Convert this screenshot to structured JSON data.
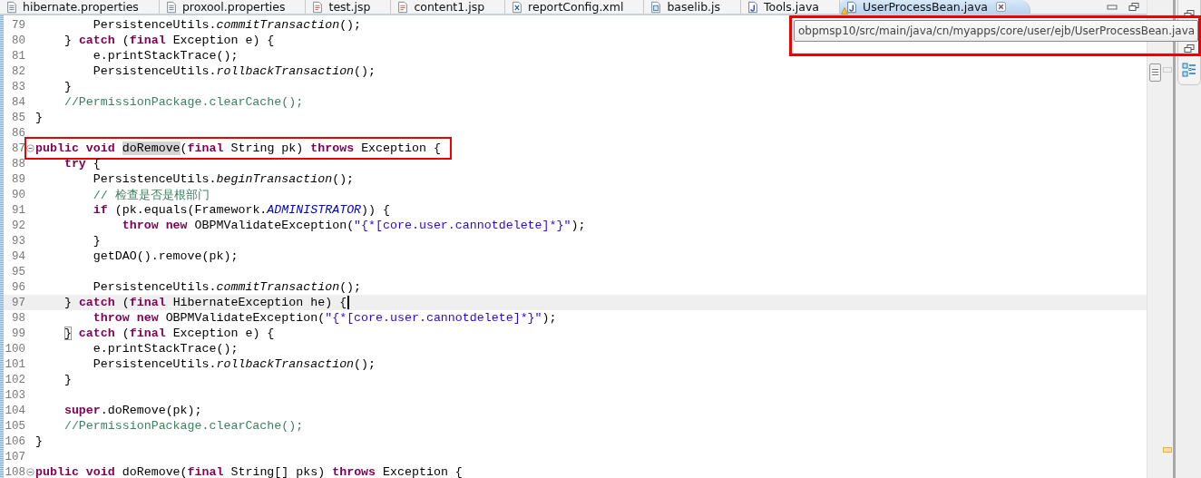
{
  "tabs": [
    {
      "label": "hibernate.properties",
      "kind": "properties",
      "selected": false,
      "warning": false
    },
    {
      "label": "proxool.properties",
      "kind": "properties",
      "selected": false,
      "warning": false
    },
    {
      "label": "test.jsp",
      "kind": "jsp",
      "selected": false,
      "warning": false
    },
    {
      "label": "content1.jsp",
      "kind": "jsp",
      "selected": false,
      "warning": false
    },
    {
      "label": "reportConfig.xml",
      "kind": "xml",
      "selected": false,
      "warning": false
    },
    {
      "label": "baselib.js",
      "kind": "js",
      "selected": false,
      "warning": false
    },
    {
      "label": "Tools.java",
      "kind": "java",
      "selected": false,
      "warning": false
    },
    {
      "label": "UserProcessBean.java",
      "kind": "java",
      "selected": true,
      "warning": true
    }
  ],
  "tooltip": {
    "text": "obpmsp10/src/main/java/cn/myapps/core/user/ejb/UserProcessBean.java",
    "highlighted": true
  },
  "editor": {
    "lines": [
      {
        "number": "79",
        "current": false,
        "tokens": [
          {
            "kind": "plain",
            "text": "        PersistenceUtils."
          },
          {
            "kind": "static",
            "text": "commitTransaction"
          },
          {
            "kind": "plain",
            "text": "();"
          }
        ]
      },
      {
        "number": "80",
        "current": false,
        "tokens": [
          {
            "kind": "plain",
            "text": "    } "
          },
          {
            "kind": "keyword",
            "text": "catch"
          },
          {
            "kind": "plain",
            "text": " ("
          },
          {
            "kind": "keyword",
            "text": "final"
          },
          {
            "kind": "plain",
            "text": " Exception e) {"
          }
        ]
      },
      {
        "number": "81",
        "current": false,
        "tokens": [
          {
            "kind": "plain",
            "text": "        e.printStackTrace();"
          }
        ]
      },
      {
        "number": "82",
        "current": false,
        "tokens": [
          {
            "kind": "plain",
            "text": "        PersistenceUtils."
          },
          {
            "kind": "static",
            "text": "rollbackTransaction"
          },
          {
            "kind": "plain",
            "text": "();"
          }
        ]
      },
      {
        "number": "83",
        "current": false,
        "tokens": [
          {
            "kind": "plain",
            "text": "    }"
          }
        ]
      },
      {
        "number": "84",
        "current": false,
        "tokens": [
          {
            "kind": "comment",
            "text": "    //PermissionPackage.clearCache();"
          }
        ]
      },
      {
        "number": "85",
        "current": false,
        "tokens": [
          {
            "kind": "plain",
            "text": "}"
          }
        ]
      },
      {
        "number": "86",
        "current": false
      },
      {
        "number": "87",
        "current": false,
        "boxed": true,
        "foldable": true,
        "tokens": [
          {
            "kind": "keyword",
            "text": "public void "
          },
          {
            "kind": "occurrence",
            "text": "doRemove"
          },
          {
            "kind": "plain",
            "text": "("
          },
          {
            "kind": "keyword",
            "text": "final"
          },
          {
            "kind": "plain",
            "text": " String pk) "
          },
          {
            "kind": "keyword",
            "text": "throws"
          },
          {
            "kind": "plain",
            "text": " Exception {"
          }
        ]
      },
      {
        "number": "88",
        "current": false,
        "tokens": [
          {
            "kind": "keyword",
            "text": "    try"
          },
          {
            "kind": "plain",
            "text": " {"
          }
        ]
      },
      {
        "number": "89",
        "current": false,
        "tokens": [
          {
            "kind": "plain",
            "text": "        PersistenceUtils."
          },
          {
            "kind": "static",
            "text": "beginTransaction"
          },
          {
            "kind": "plain",
            "text": "();"
          }
        ]
      },
      {
        "number": "90",
        "current": false,
        "tokens": [
          {
            "kind": "comment",
            "text": "        // "
          },
          {
            "kind": "cjk",
            "text": "检查是否是根部门"
          }
        ]
      },
      {
        "number": "91",
        "current": false,
        "tokens": [
          {
            "kind": "keyword",
            "text": "        if"
          },
          {
            "kind": "plain",
            "text": " (pk.equals(Framework."
          },
          {
            "kind": "constant",
            "text": "ADMINISTRATOR"
          },
          {
            "kind": "plain",
            "text": ")) {"
          }
        ]
      },
      {
        "number": "92",
        "current": false,
        "tokens": [
          {
            "kind": "keyword",
            "text": "            throw new"
          },
          {
            "kind": "plain",
            "text": " OBPMValidateException("
          },
          {
            "kind": "string",
            "text": "\"{*[core.user.cannotdelete]*}\""
          },
          {
            "kind": "plain",
            "text": ");"
          }
        ]
      },
      {
        "number": "93",
        "current": false,
        "tokens": [
          {
            "kind": "plain",
            "text": "        }"
          }
        ]
      },
      {
        "number": "94",
        "current": false,
        "tokens": [
          {
            "kind": "plain",
            "text": "        getDAO().remove(pk);"
          }
        ]
      },
      {
        "number": "95",
        "current": false
      },
      {
        "number": "96",
        "current": false,
        "tokens": [
          {
            "kind": "plain",
            "text": "        PersistenceUtils."
          },
          {
            "kind": "static",
            "text": "commitTransaction"
          },
          {
            "kind": "plain",
            "text": "();"
          }
        ]
      },
      {
        "number": "97",
        "current": true,
        "tokens": [
          {
            "kind": "plain",
            "text": "    } "
          },
          {
            "kind": "keyword",
            "text": "catch"
          },
          {
            "kind": "plain",
            "text": " ("
          },
          {
            "kind": "keyword",
            "text": "final"
          },
          {
            "kind": "plain",
            "text": " HibernateException he) {"
          }
        ]
      },
      {
        "number": "98",
        "current": false,
        "tokens": [
          {
            "kind": "keyword",
            "text": "        throw new"
          },
          {
            "kind": "plain",
            "text": " OBPMValidateException("
          },
          {
            "kind": "string",
            "text": "\"{*[core.user.cannotdelete]*}\""
          },
          {
            "kind": "plain",
            "text": ");"
          }
        ]
      },
      {
        "number": "99",
        "current": false,
        "tokens": [
          {
            "kind": "bracket",
            "text": "    }"
          },
          {
            "kind": "keyword",
            "text": " catch"
          },
          {
            "kind": "plain",
            "text": " ("
          },
          {
            "kind": "keyword",
            "text": "final"
          },
          {
            "kind": "plain",
            "text": " Exception e) {"
          }
        ]
      },
      {
        "number": "100",
        "current": false,
        "tokens": [
          {
            "kind": "plain",
            "text": "        e.printStackTrace();"
          }
        ]
      },
      {
        "number": "101",
        "current": false,
        "tokens": [
          {
            "kind": "plain",
            "text": "        PersistenceUtils."
          },
          {
            "kind": "static",
            "text": "rollbackTransaction"
          },
          {
            "kind": "plain",
            "text": "();"
          }
        ]
      },
      {
        "number": "102",
        "current": false,
        "tokens": [
          {
            "kind": "plain",
            "text": "    }"
          }
        ]
      },
      {
        "number": "103",
        "current": false
      },
      {
        "number": "104",
        "current": false,
        "tokens": [
          {
            "kind": "keyword",
            "text": "    super"
          },
          {
            "kind": "plain",
            "text": ".doRemove(pk);"
          }
        ]
      },
      {
        "number": "105",
        "current": false,
        "tokens": [
          {
            "kind": "comment",
            "text": "    //PermissionPackage.clearCache();"
          }
        ]
      },
      {
        "number": "106",
        "current": false,
        "tokens": [
          {
            "kind": "plain",
            "text": "}"
          }
        ]
      },
      {
        "number": "107",
        "current": false
      },
      {
        "number": "108",
        "current": false,
        "foldable": true,
        "tokens": [
          {
            "kind": "keyword",
            "text": "public void"
          },
          {
            "kind": "plain",
            "text": " doRemove("
          },
          {
            "kind": "keyword",
            "text": "final"
          },
          {
            "kind": "plain",
            "text": " String[] pks) "
          },
          {
            "kind": "keyword",
            "text": "throws"
          },
          {
            "kind": "plain",
            "text": " Exception {"
          }
        ]
      }
    ]
  }
}
